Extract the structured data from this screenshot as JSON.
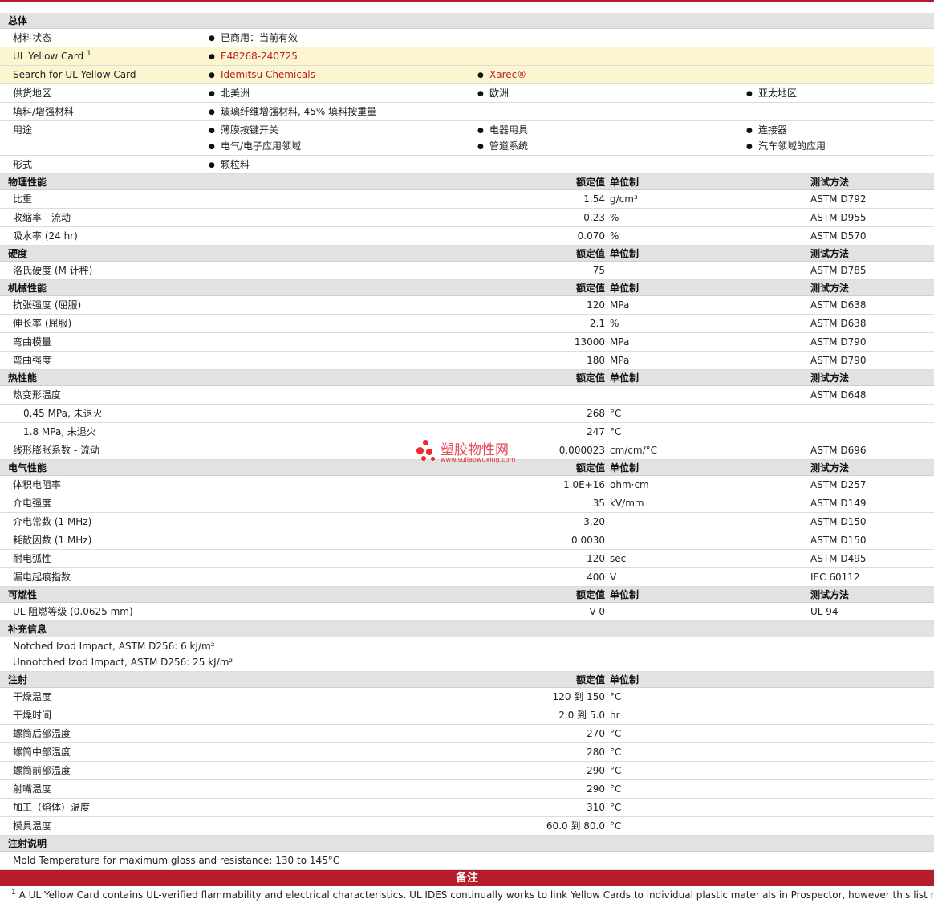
{
  "general": {
    "header": "总体",
    "status_label": "材料状态",
    "status_value": "已商用：当前有效",
    "ulcard_label": "UL Yellow Card",
    "ulcard_sup": "1",
    "ulcard_value": "E48268-240725",
    "search_label": "Search for UL Yellow Card",
    "search_links": [
      "Idemitsu Chemicals",
      "Xarec®"
    ],
    "supply_label": "供货地区",
    "supply_values": [
      "北美洲",
      "欧洲",
      "亚太地区"
    ],
    "filler_label": "填料/增强材料",
    "filler_value": "玻璃纤维增强材料, 45% 填料按重量",
    "uses_label": "用途",
    "uses": [
      "薄膜按键开关",
      "电器用具",
      "连接器",
      "电气/电子应用领域",
      "管道系统",
      "汽车领域的应用"
    ],
    "form_label": "形式",
    "form_value": "颗粒料"
  },
  "col_headers": {
    "nominal": "额定值",
    "unit": "单位制",
    "method": "测试方法"
  },
  "physical": {
    "title": "物理性能",
    "rows": [
      {
        "label": "比重",
        "value": "1.54",
        "unit": "g/cm³",
        "method": "ASTM D792"
      },
      {
        "label": "收缩率 - 流动",
        "value": "0.23",
        "unit": "%",
        "method": "ASTM D955"
      },
      {
        "label": "吸水率 (24 hr)",
        "value": "0.070",
        "unit": "%",
        "method": "ASTM D570"
      }
    ]
  },
  "hardness": {
    "title": "硬度",
    "rows": [
      {
        "label": "洛氏硬度 (M 计秤)",
        "value": "75",
        "unit": "",
        "method": "ASTM D785"
      }
    ]
  },
  "mechanical": {
    "title": "机械性能",
    "rows": [
      {
        "label": "抗张强度 (屈服)",
        "value": "120",
        "unit": "MPa",
        "method": "ASTM D638"
      },
      {
        "label": "伸长率 (屈服)",
        "value": "2.1",
        "unit": "%",
        "method": "ASTM D638"
      },
      {
        "label": "弯曲模量",
        "value": "13000",
        "unit": "MPa",
        "method": "ASTM D790"
      },
      {
        "label": "弯曲强度",
        "value": "180",
        "unit": "MPa",
        "method": "ASTM D790"
      }
    ]
  },
  "thermal": {
    "title": "热性能",
    "rows": [
      {
        "label": "热变形温度",
        "value": "",
        "unit": "",
        "method": "ASTM D648"
      },
      {
        "label": "0.45 MPa, 未退火",
        "value": "268",
        "unit": "°C",
        "method": ""
      },
      {
        "label": "1.8 MPa, 未退火",
        "value": "247",
        "unit": "°C",
        "method": ""
      },
      {
        "label": "线形膨胀系数 - 流动",
        "value": "0.000023",
        "unit": "cm/cm/°C",
        "method": "ASTM D696"
      }
    ]
  },
  "electrical": {
    "title": "电气性能",
    "rows": [
      {
        "label": "体积电阻率",
        "value": "1.0E+16",
        "unit": "ohm·cm",
        "method": "ASTM D257"
      },
      {
        "label": "介电强度",
        "value": "35",
        "unit": "kV/mm",
        "method": "ASTM D149"
      },
      {
        "label": "介电常数 (1 MHz)",
        "value": "3.20",
        "unit": "",
        "method": "ASTM D150"
      },
      {
        "label": "耗散因数 (1 MHz)",
        "value": "0.0030",
        "unit": "",
        "method": "ASTM D150"
      },
      {
        "label": "耐电弧性",
        "value": "120",
        "unit": "sec",
        "method": "ASTM D495"
      },
      {
        "label": "漏电起痕指数",
        "value": "400",
        "unit": "V",
        "method": "IEC 60112"
      }
    ]
  },
  "flammability": {
    "title": "可燃性",
    "rows": [
      {
        "label": "UL 阻燃等级 (0.0625 mm)",
        "value": "V-0",
        "unit": "",
        "method": "UL 94"
      }
    ]
  },
  "supplement": {
    "title": "补充信息",
    "lines": [
      "Notched Izod Impact, ASTM D256: 6 kJ/m²",
      "Unnotched Izod Impact, ASTM D256: 25 kJ/m²"
    ]
  },
  "injection": {
    "title": "注射",
    "rows": [
      {
        "label": "干燥温度",
        "value": "120 到  150",
        "unit": "°C"
      },
      {
        "label": "干燥时间",
        "value": "2.0 到  5.0",
        "unit": "hr"
      },
      {
        "label": "螺筒后部温度",
        "value": "270",
        "unit": "°C"
      },
      {
        "label": "螺筒中部温度",
        "value": "280",
        "unit": "°C"
      },
      {
        "label": "螺筒前部温度",
        "value": "290",
        "unit": "°C"
      },
      {
        "label": "射嘴温度",
        "value": "290",
        "unit": "°C"
      },
      {
        "label": "加工（熔体）温度",
        "value": "310",
        "unit": "°C"
      },
      {
        "label": "模具温度",
        "value": "60.0 到  80.0",
        "unit": "°C"
      }
    ]
  },
  "injection_notes": {
    "title": "注射说明",
    "line": "Mold Temperature for maximum gloss and resistance: 130 to 145°C"
  },
  "remarks": {
    "title": "备注",
    "sup": "1",
    "text": "A UL Yellow Card contains UL-verified flammability and electrical characteristics. UL IDES continually works to link Yellow Cards to individual plastic materials in Prospector, however this list may not"
  },
  "watermark": {
    "cn": "塑胶物性网",
    "url": "www.sujiaowuxing.com",
    "color": "#e64a5a"
  }
}
